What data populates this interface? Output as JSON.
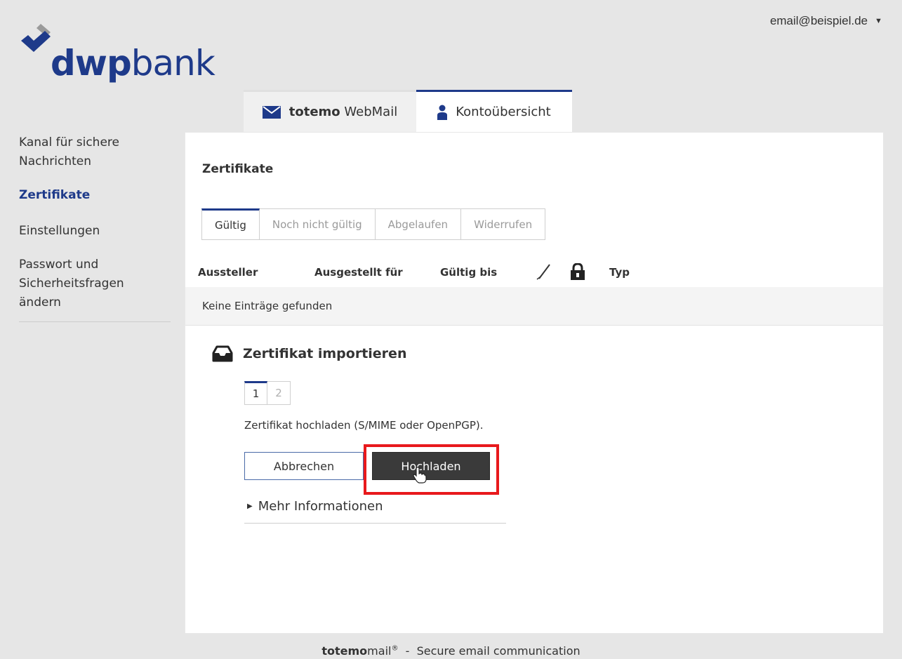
{
  "brand": {
    "logo_bold": "dwp",
    "logo_regular": "bank",
    "primary_color": "#1e3a8a",
    "icon": "diamond-check-logo-icon"
  },
  "account": {
    "email": "email@beispiel.de",
    "caret_icon": "caret-down-icon"
  },
  "tabs": [
    {
      "brand": "totemo",
      "label": "WebMail",
      "icon": "envelope-icon",
      "active": false
    },
    {
      "label": "Kontoübersicht",
      "icon": "user-icon",
      "active": true
    }
  ],
  "sidebar": {
    "items": [
      {
        "label_line1": "Kanal für sichere",
        "label_line2": "Nachrichten",
        "active": false
      },
      {
        "label": "Zertifikate",
        "active": true
      },
      {
        "label": "Einstellungen",
        "active": false
      },
      {
        "label_line1": "Passwort und",
        "label_line2": "Sicherheitsfragen",
        "label_line3": "ändern",
        "active": false
      }
    ]
  },
  "main": {
    "title": "Zertifikate",
    "filters": [
      {
        "label": "Gültig",
        "active": true
      },
      {
        "label": "Noch nicht gültig",
        "active": false
      },
      {
        "label": "Abgelaufen",
        "active": false
      },
      {
        "label": "Widerrufen",
        "active": false
      }
    ],
    "columns": {
      "issuer": "Aussteller",
      "issued_to": "Ausgestellt für",
      "valid_until": "Gültig bis",
      "sign_icon": "signature-pen-icon",
      "lock_icon": "lock-icon",
      "type": "Typ"
    },
    "empty_message": "Keine Einträge gefunden",
    "import": {
      "icon": "inbox-tray-icon",
      "title": "Zertifikat importieren",
      "steps": [
        "1",
        "2"
      ],
      "active_step": 1,
      "description": "Zertifikat hochladen (S/MIME oder OpenPGP).",
      "cancel_label": "Abbrechen",
      "upload_label": "Hochladen",
      "highlight_color": "#e8191c",
      "more_label": "Mehr Informationen"
    }
  },
  "footer": {
    "brand_bold": "totemo",
    "brand_regular": "mail",
    "registered": "®",
    "separator": "-",
    "tagline": "Secure email communication"
  }
}
